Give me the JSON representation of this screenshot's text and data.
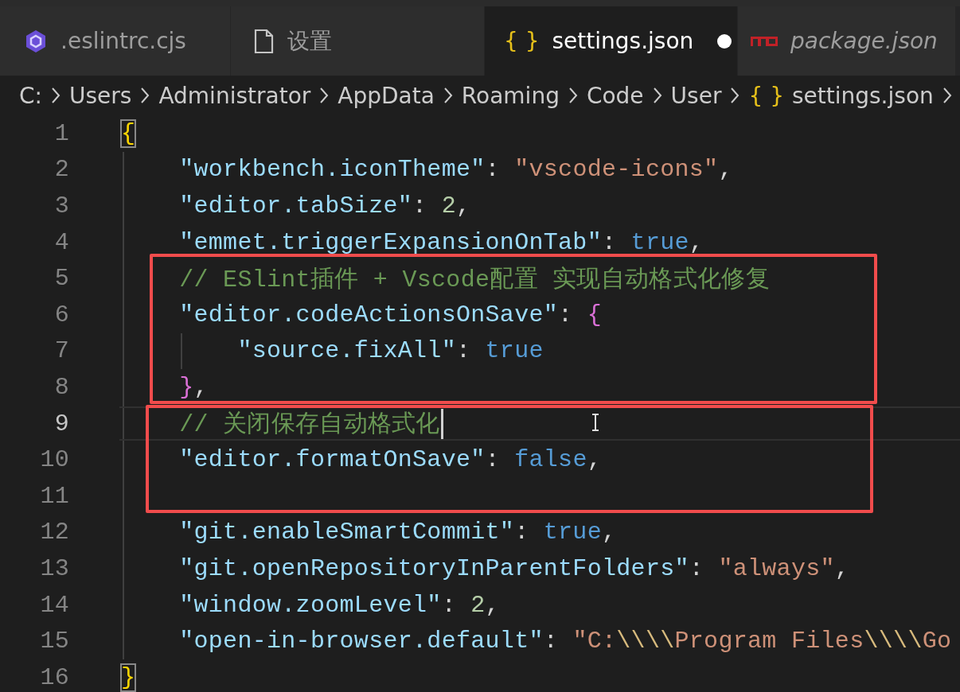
{
  "tabs": [
    {
      "label": ".eslintrc.cjs",
      "kind": "hexagon",
      "selected": false,
      "modified": false,
      "preview": false
    },
    {
      "label": "设置",
      "kind": "file",
      "selected": false,
      "modified": false,
      "preview": false
    },
    {
      "label": "settings.json",
      "kind": "braces",
      "icon_text": "{ }",
      "selected": true,
      "modified": true,
      "preview": false
    },
    {
      "label": "package.json",
      "kind": "npm",
      "selected": false,
      "modified": false,
      "preview": true
    }
  ],
  "breadcrumb": [
    {
      "text": "C:"
    },
    {
      "text": "Users"
    },
    {
      "text": "Administrator"
    },
    {
      "text": "AppData"
    },
    {
      "text": "Roaming"
    },
    {
      "text": "Code"
    },
    {
      "text": "User"
    },
    {
      "text": "settings.json",
      "icon_text": "{ }"
    }
  ],
  "editor": {
    "blocks": [
      {
        "boxed": false,
        "lines": [
          {
            "number": "1",
            "current": false,
            "tokens": [
              {
                "kind": "brace1",
                "text": "{",
                "matched": true
              }
            ]
          },
          {
            "number": "2",
            "current": false,
            "tokens": [
              {
                "kind": "key",
                "text": "\"workbench.iconTheme\""
              },
              {
                "kind": "punct",
                "text": ": "
              },
              {
                "kind": "string",
                "text": "\"vscode-icons\""
              },
              {
                "kind": "punct",
                "text": ","
              }
            ]
          },
          {
            "number": "3",
            "current": false,
            "tokens": [
              {
                "kind": "key",
                "text": "\"editor.tabSize\""
              },
              {
                "kind": "punct",
                "text": ": "
              },
              {
                "kind": "number",
                "text": "2"
              },
              {
                "kind": "punct",
                "text": ","
              }
            ]
          },
          {
            "number": "4",
            "current": false,
            "tokens": [
              {
                "kind": "key",
                "text": "\"emmet.triggerExpansionOnTab\""
              },
              {
                "kind": "punct",
                "text": ": "
              },
              {
                "kind": "bool",
                "text": "true"
              },
              {
                "kind": "punct",
                "text": ","
              }
            ]
          }
        ]
      },
      {
        "boxed": true,
        "lines": [
          {
            "number": "5",
            "current": false,
            "tokens": [
              {
                "kind": "comment",
                "text": "// ESlint插件 + Vscode配置 实现自动格式化修复"
              }
            ]
          },
          {
            "number": "6",
            "current": false,
            "tokens": [
              {
                "kind": "key",
                "text": "\"editor.codeActionsOnSave\""
              },
              {
                "kind": "punct",
                "text": ": "
              },
              {
                "kind": "brace2",
                "text": "{"
              }
            ]
          },
          {
            "number": "7",
            "current": false,
            "tokens": [
              {
                "kind": "key",
                "text": "\"source.fixAll\""
              },
              {
                "kind": "punct",
                "text": ": "
              },
              {
                "kind": "bool",
                "text": "true"
              }
            ]
          },
          {
            "number": "8",
            "current": false,
            "tokens": [
              {
                "kind": "brace2",
                "text": "}"
              },
              {
                "kind": "punct",
                "text": ","
              }
            ]
          }
        ]
      },
      {
        "boxed": true,
        "lines": [
          {
            "number": "9",
            "current": true,
            "tokens": [
              {
                "kind": "comment",
                "text": "// 关闭保存自动格式化"
              }
            ]
          },
          {
            "number": "10",
            "current": false,
            "tokens": [
              {
                "kind": "key",
                "text": "\"editor.formatOnSave\""
              },
              {
                "kind": "punct",
                "text": ": "
              },
              {
                "kind": "bool",
                "text": "false"
              },
              {
                "kind": "punct",
                "text": ","
              }
            ]
          },
          {
            "number": "11",
            "current": false
          }
        ]
      },
      {
        "boxed": false,
        "lines": [
          {
            "number": "12",
            "current": false,
            "tokens": [
              {
                "kind": "key",
                "text": "\"git.enableSmartCommit\""
              },
              {
                "kind": "punct",
                "text": ": "
              },
              {
                "kind": "bool",
                "text": "true"
              },
              {
                "kind": "punct",
                "text": ","
              }
            ]
          },
          {
            "number": "13",
            "current": false,
            "tokens": [
              {
                "kind": "key",
                "text": "\"git.openRepositoryInParentFolders\""
              },
              {
                "kind": "punct",
                "text": ": "
              },
              {
                "kind": "string",
                "text": "\"always\""
              },
              {
                "kind": "punct",
                "text": ","
              }
            ]
          },
          {
            "number": "14",
            "current": false,
            "tokens": [
              {
                "kind": "key",
                "text": "\"window.zoomLevel\""
              },
              {
                "kind": "punct",
                "text": ": "
              },
              {
                "kind": "number",
                "text": "2"
              },
              {
                "kind": "punct",
                "text": ","
              }
            ]
          },
          {
            "number": "15",
            "current": false,
            "tokens": [
              {
                "kind": "key",
                "text": "\"open-in-browser.default\""
              },
              {
                "kind": "punct",
                "text": ": "
              },
              {
                "kind": "string",
                "text": "\"C:"
              },
              {
                "kind": "escape",
                "text": "\\\\\\\\"
              },
              {
                "kind": "string",
                "text": "Program Files"
              },
              {
                "kind": "escape",
                "text": "\\\\\\\\"
              },
              {
                "kind": "string",
                "text": "Go"
              }
            ]
          },
          {
            "number": "16",
            "current": false,
            "tokens": [
              {
                "kind": "brace1",
                "text": "}",
                "matched": true
              }
            ]
          }
        ]
      }
    ]
  }
}
